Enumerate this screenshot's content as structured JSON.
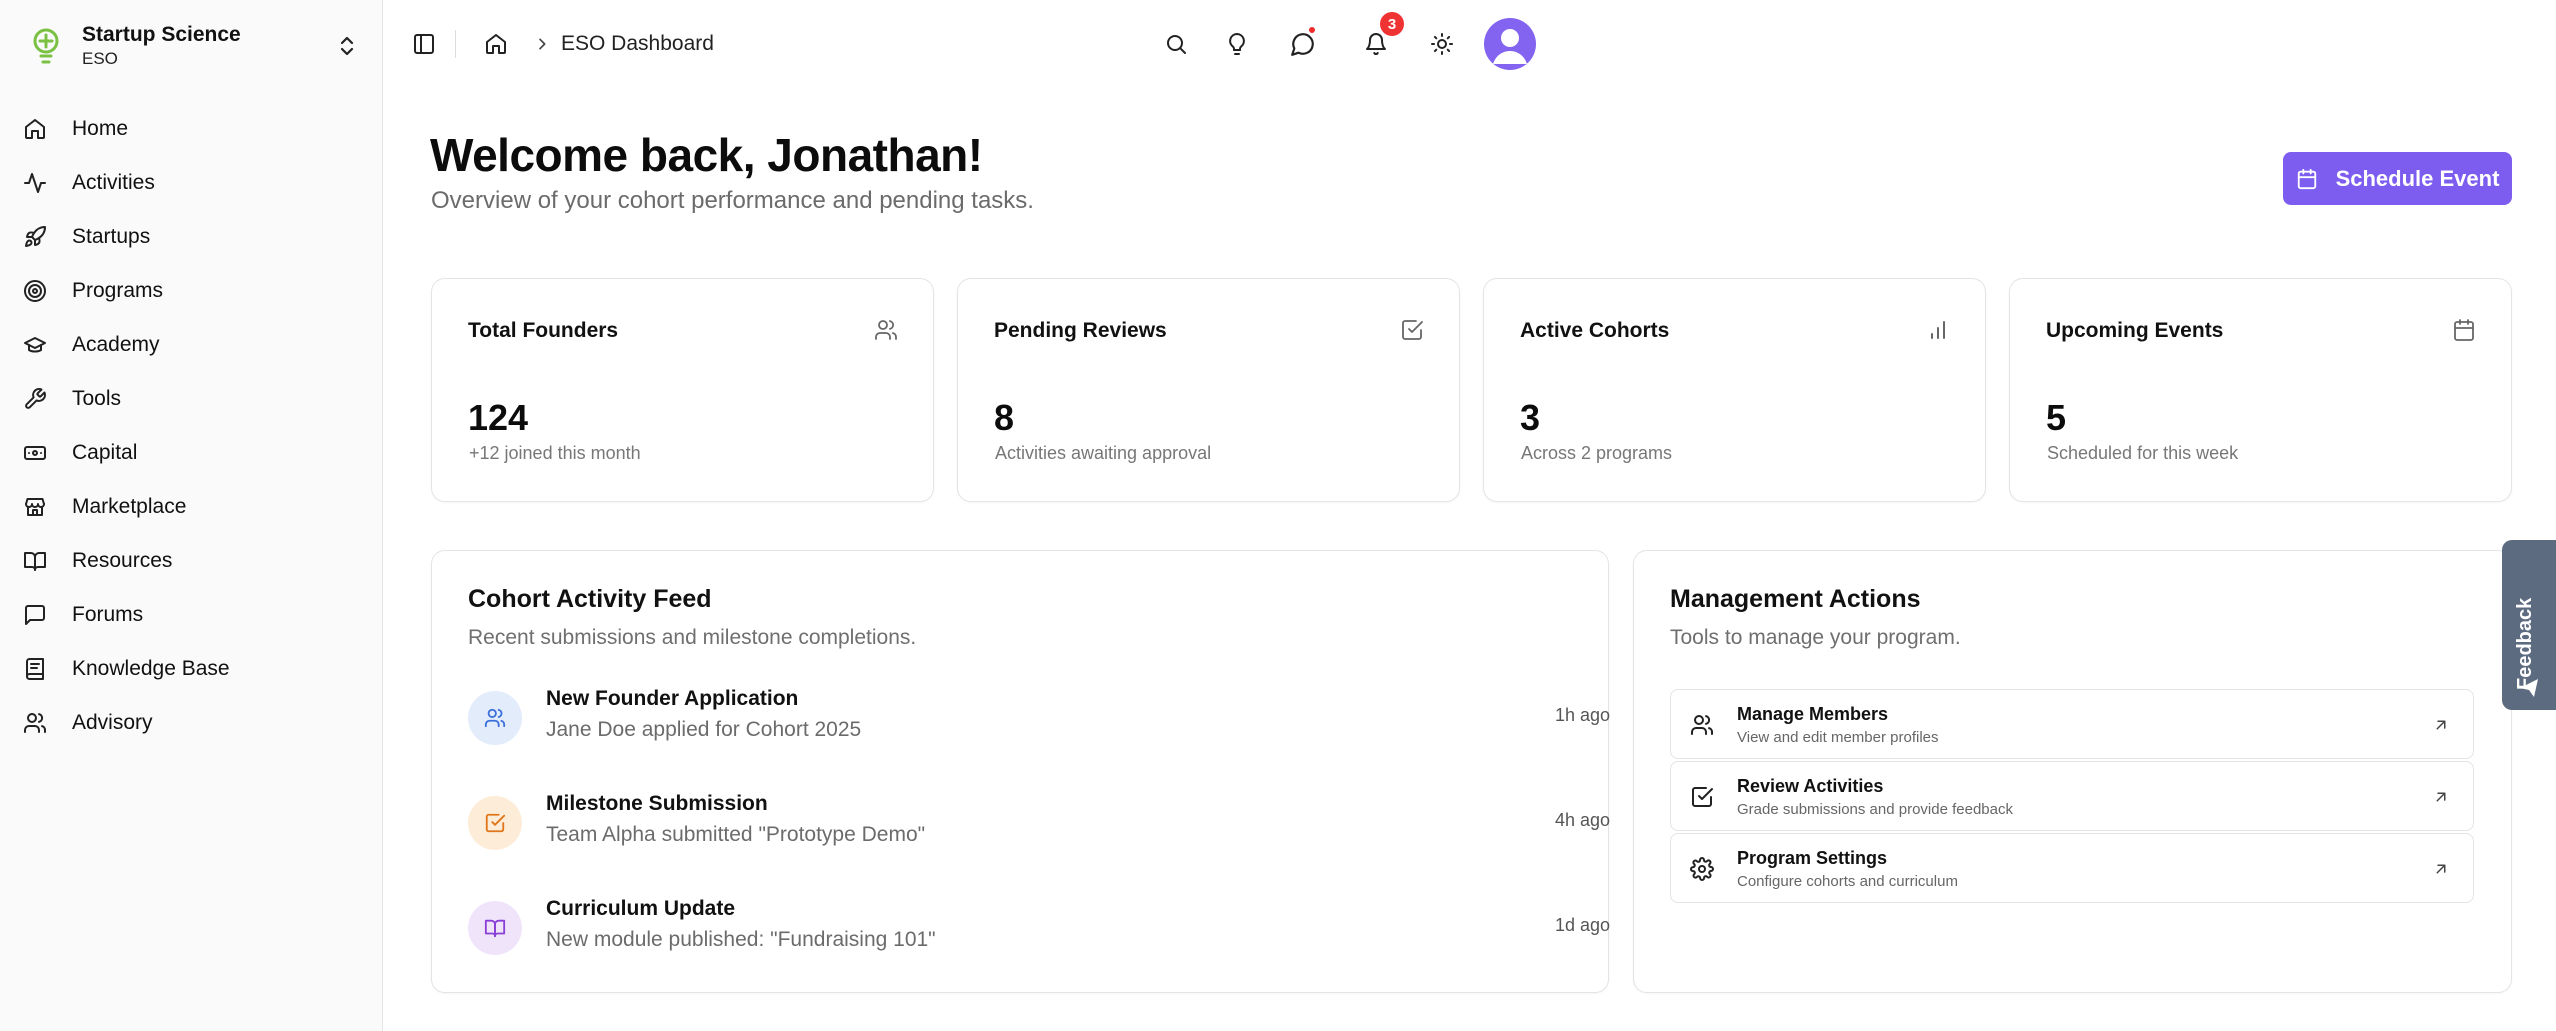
{
  "brand": {
    "name": "Startup Science",
    "subtitle": "ESO",
    "accent": "#7ac143"
  },
  "sidebar": {
    "items": [
      {
        "label": "Home",
        "icon": "home-icon"
      },
      {
        "label": "Activities",
        "icon": "activity-icon"
      },
      {
        "label": "Startups",
        "icon": "rocket-icon"
      },
      {
        "label": "Programs",
        "icon": "target-icon"
      },
      {
        "label": "Academy",
        "icon": "graduation-cap-icon"
      },
      {
        "label": "Tools",
        "icon": "wrench-icon"
      },
      {
        "label": "Capital",
        "icon": "banknote-icon"
      },
      {
        "label": "Marketplace",
        "icon": "store-icon"
      },
      {
        "label": "Resources",
        "icon": "book-open-icon"
      },
      {
        "label": "Forums",
        "icon": "message-square-icon"
      },
      {
        "label": "Knowledge Base",
        "icon": "book-icon"
      },
      {
        "label": "Advisory",
        "icon": "users-icon"
      }
    ]
  },
  "header": {
    "breadcrumb": "ESO Dashboard",
    "notification_count": "3",
    "notification_color": "#ef3333"
  },
  "main": {
    "welcome": "Welcome back, Jonathan!",
    "subtitle": "Overview of your cohort performance and pending tasks.",
    "schedule_button": "Schedule Event",
    "button_color": "#7c5df0"
  },
  "stats": [
    {
      "title": "Total Founders",
      "value": "124",
      "note": "+12 joined this month",
      "icon": "users-icon"
    },
    {
      "title": "Pending Reviews",
      "value": "8",
      "note": "Activities awaiting approval",
      "icon": "check-square-icon"
    },
    {
      "title": "Active Cohorts",
      "value": "3",
      "note": "Across 2 programs",
      "icon": "bar-chart-icon"
    },
    {
      "title": "Upcoming Events",
      "value": "5",
      "note": "Scheduled for this week",
      "icon": "calendar-icon"
    }
  ],
  "feed": {
    "title": "Cohort Activity Feed",
    "subtitle": "Recent submissions and milestone completions.",
    "items": [
      {
        "title": "New Founder Application",
        "desc": "Jane Doe applied for Cohort 2025",
        "time": "1h ago",
        "icon": "users-icon"
      },
      {
        "title": "Milestone Submission",
        "desc": "Team Alpha submitted \"Prototype Demo\"",
        "time": "4h ago",
        "icon": "check-square-icon"
      },
      {
        "title": "Curriculum Update",
        "desc": "New module published: \"Fundraising 101\"",
        "time": "1d ago",
        "icon": "book-open-icon"
      }
    ]
  },
  "management": {
    "title": "Management Actions",
    "subtitle": "Tools to manage your program.",
    "items": [
      {
        "title": "Manage Members",
        "desc": "View and edit member profiles",
        "icon": "users-icon"
      },
      {
        "title": "Review Activities",
        "desc": "Grade submissions and provide feedback",
        "icon": "check-square-icon"
      },
      {
        "title": "Program Settings",
        "desc": "Configure cohorts and curriculum",
        "icon": "gear-icon"
      }
    ]
  },
  "feedback": {
    "label": "Feedback"
  }
}
